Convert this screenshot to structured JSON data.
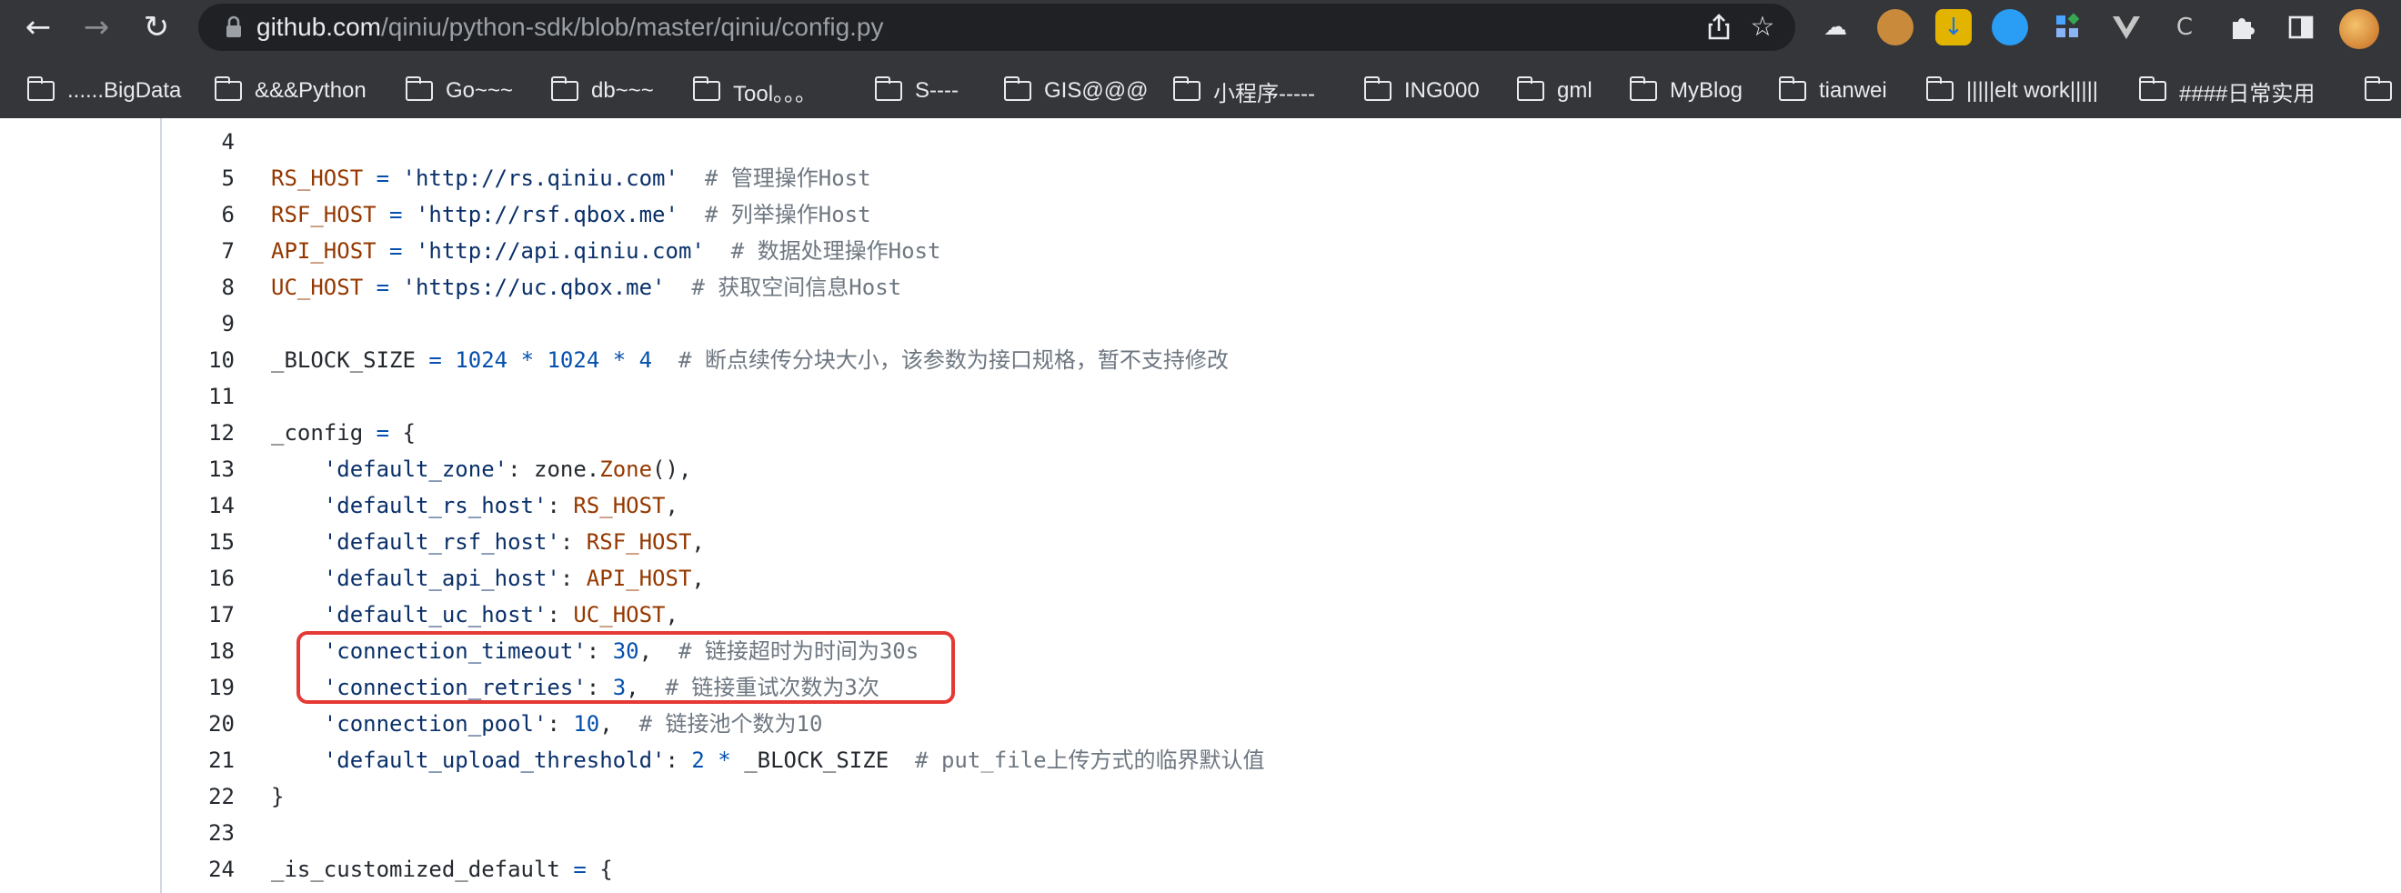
{
  "browser": {
    "url_host": "github.com",
    "url_path": "/qiniu/python-sdk/blob/master/qiniu/config.py",
    "bookmarks": [
      "......BigData",
      "&&&Python",
      "Go~~~",
      "db~~~",
      "Tool。。。",
      "S----",
      "GIS@@@",
      "小程序-----",
      "ING000",
      "gml",
      "MyBlog",
      "tianwei",
      "|||||elt work|||||",
      "####日常实用"
    ]
  },
  "code": {
    "lines": [
      {
        "n": "4",
        "tokens": []
      },
      {
        "n": "5",
        "tokens": [
          {
            "t": "RS_HOST",
            "c": "name"
          },
          {
            "t": " ",
            "c": "pl"
          },
          {
            "t": "=",
            "c": "op"
          },
          {
            "t": " ",
            "c": "pl"
          },
          {
            "t": "'http://rs.qiniu.com'",
            "c": "str"
          },
          {
            "t": "  ",
            "c": "pl"
          },
          {
            "t": "# 管理操作Host",
            "c": "cm"
          }
        ]
      },
      {
        "n": "6",
        "tokens": [
          {
            "t": "RSF_HOST",
            "c": "name"
          },
          {
            "t": " ",
            "c": "pl"
          },
          {
            "t": "=",
            "c": "op"
          },
          {
            "t": " ",
            "c": "pl"
          },
          {
            "t": "'http://rsf.qbox.me'",
            "c": "str"
          },
          {
            "t": "  ",
            "c": "pl"
          },
          {
            "t": "# 列举操作Host",
            "c": "cm"
          }
        ]
      },
      {
        "n": "7",
        "tokens": [
          {
            "t": "API_HOST",
            "c": "name"
          },
          {
            "t": " ",
            "c": "pl"
          },
          {
            "t": "=",
            "c": "op"
          },
          {
            "t": " ",
            "c": "pl"
          },
          {
            "t": "'http://api.qiniu.com'",
            "c": "str"
          },
          {
            "t": "  ",
            "c": "pl"
          },
          {
            "t": "# 数据处理操作Host",
            "c": "cm"
          }
        ]
      },
      {
        "n": "8",
        "tokens": [
          {
            "t": "UC_HOST",
            "c": "name"
          },
          {
            "t": " ",
            "c": "pl"
          },
          {
            "t": "=",
            "c": "op"
          },
          {
            "t": " ",
            "c": "pl"
          },
          {
            "t": "'https://uc.qbox.me'",
            "c": "str"
          },
          {
            "t": "  ",
            "c": "pl"
          },
          {
            "t": "# 获取空间信息Host",
            "c": "cm"
          }
        ]
      },
      {
        "n": "9",
        "tokens": []
      },
      {
        "n": "10",
        "tokens": [
          {
            "t": "_BLOCK_SIZE",
            "c": "pl"
          },
          {
            "t": " ",
            "c": "pl"
          },
          {
            "t": "=",
            "c": "op"
          },
          {
            "t": " ",
            "c": "pl"
          },
          {
            "t": "1024",
            "c": "num"
          },
          {
            "t": " ",
            "c": "pl"
          },
          {
            "t": "*",
            "c": "op"
          },
          {
            "t": " ",
            "c": "pl"
          },
          {
            "t": "1024",
            "c": "num"
          },
          {
            "t": " ",
            "c": "pl"
          },
          {
            "t": "*",
            "c": "op"
          },
          {
            "t": " ",
            "c": "pl"
          },
          {
            "t": "4",
            "c": "num"
          },
          {
            "t": "  ",
            "c": "pl"
          },
          {
            "t": "# 断点续传分块大小，该参数为接口规格，暂不支持修改",
            "c": "cm"
          }
        ]
      },
      {
        "n": "11",
        "tokens": []
      },
      {
        "n": "12",
        "tokens": [
          {
            "t": "_config",
            "c": "pl"
          },
          {
            "t": " ",
            "c": "pl"
          },
          {
            "t": "=",
            "c": "op"
          },
          {
            "t": " {",
            "c": "pl"
          }
        ]
      },
      {
        "n": "13",
        "tokens": [
          {
            "t": "    ",
            "c": "pl"
          },
          {
            "t": "'default_zone'",
            "c": "str"
          },
          {
            "t": ": zone.",
            "c": "pl"
          },
          {
            "t": "Zone",
            "c": "name"
          },
          {
            "t": "(),",
            "c": "pl"
          }
        ]
      },
      {
        "n": "14",
        "tokens": [
          {
            "t": "    ",
            "c": "pl"
          },
          {
            "t": "'default_rs_host'",
            "c": "str"
          },
          {
            "t": ": ",
            "c": "pl"
          },
          {
            "t": "RS_HOST",
            "c": "name"
          },
          {
            "t": ",",
            "c": "pl"
          }
        ]
      },
      {
        "n": "15",
        "tokens": [
          {
            "t": "    ",
            "c": "pl"
          },
          {
            "t": "'default_rsf_host'",
            "c": "str"
          },
          {
            "t": ": ",
            "c": "pl"
          },
          {
            "t": "RSF_HOST",
            "c": "name"
          },
          {
            "t": ",",
            "c": "pl"
          }
        ]
      },
      {
        "n": "16",
        "tokens": [
          {
            "t": "    ",
            "c": "pl"
          },
          {
            "t": "'default_api_host'",
            "c": "str"
          },
          {
            "t": ": ",
            "c": "pl"
          },
          {
            "t": "API_HOST",
            "c": "name"
          },
          {
            "t": ",",
            "c": "pl"
          }
        ]
      },
      {
        "n": "17",
        "tokens": [
          {
            "t": "    ",
            "c": "pl"
          },
          {
            "t": "'default_uc_host'",
            "c": "str"
          },
          {
            "t": ": ",
            "c": "pl"
          },
          {
            "t": "UC_HOST",
            "c": "name"
          },
          {
            "t": ",",
            "c": "pl"
          }
        ]
      },
      {
        "n": "18",
        "tokens": [
          {
            "t": "    ",
            "c": "pl"
          },
          {
            "t": "'connection_timeout'",
            "c": "str"
          },
          {
            "t": ": ",
            "c": "pl"
          },
          {
            "t": "30",
            "c": "num"
          },
          {
            "t": ",  ",
            "c": "pl"
          },
          {
            "t": "# 链接超时为时间为30s",
            "c": "cm"
          }
        ]
      },
      {
        "n": "19",
        "tokens": [
          {
            "t": "    ",
            "c": "pl"
          },
          {
            "t": "'connection_retries'",
            "c": "str"
          },
          {
            "t": ": ",
            "c": "pl"
          },
          {
            "t": "3",
            "c": "num"
          },
          {
            "t": ",  ",
            "c": "pl"
          },
          {
            "t": "# 链接重试次数为3次",
            "c": "cm"
          }
        ]
      },
      {
        "n": "20",
        "tokens": [
          {
            "t": "    ",
            "c": "pl"
          },
          {
            "t": "'connection_pool'",
            "c": "str"
          },
          {
            "t": ": ",
            "c": "pl"
          },
          {
            "t": "10",
            "c": "num"
          },
          {
            "t": ",  ",
            "c": "pl"
          },
          {
            "t": "# 链接池个数为10",
            "c": "cm"
          }
        ]
      },
      {
        "n": "21",
        "tokens": [
          {
            "t": "    ",
            "c": "pl"
          },
          {
            "t": "'default_upload_threshold'",
            "c": "str"
          },
          {
            "t": ": ",
            "c": "pl"
          },
          {
            "t": "2",
            "c": "num"
          },
          {
            "t": " ",
            "c": "pl"
          },
          {
            "t": "*",
            "c": "op"
          },
          {
            "t": " _BLOCK_SIZE",
            "c": "pl"
          },
          {
            "t": "  ",
            "c": "pl"
          },
          {
            "t": "# put_file上传方式的临界默认值",
            "c": "cm"
          }
        ]
      },
      {
        "n": "22",
        "tokens": [
          {
            "t": "}",
            "c": "pl"
          }
        ]
      },
      {
        "n": "23",
        "tokens": []
      },
      {
        "n": "24",
        "tokens": [
          {
            "t": "_is_customized_default",
            "c": "pl"
          },
          {
            "t": " ",
            "c": "pl"
          },
          {
            "t": "=",
            "c": "op"
          },
          {
            "t": " {",
            "c": "pl"
          }
        ]
      }
    ]
  },
  "colors": {
    "chrome_bg": "#35363a",
    "urlbar_bg": "#202124",
    "syntax_name": "#953800",
    "syntax_string": "#0a3069",
    "syntax_number": "#0550ae",
    "syntax_comment": "#6e7781",
    "highlight_box": "#e53935"
  }
}
